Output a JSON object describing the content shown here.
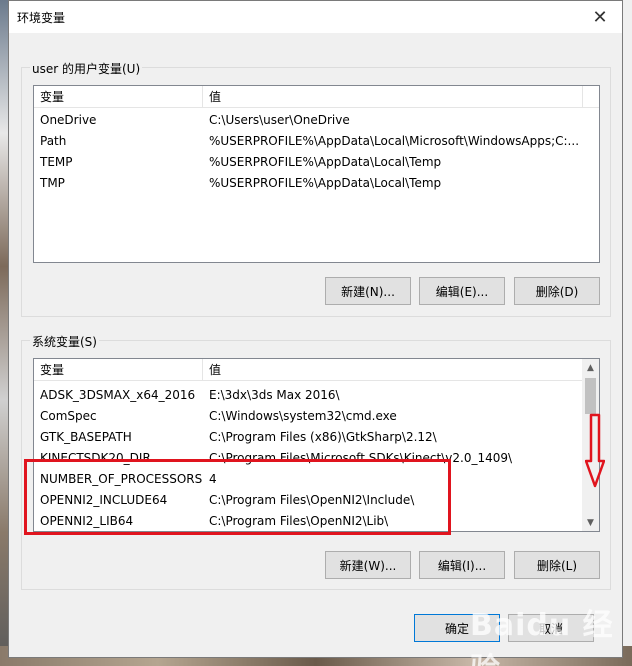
{
  "window": {
    "title": "环境变量",
    "close_glyph": "✕"
  },
  "user_section": {
    "label": "user 的用户变量(U)",
    "columns": [
      "变量",
      "值"
    ],
    "rows": [
      {
        "name": "OneDrive",
        "value": "C:\\Users\\user\\OneDrive"
      },
      {
        "name": "Path",
        "value": "%USERPROFILE%\\AppData\\Local\\Microsoft\\WindowsApps;C:..."
      },
      {
        "name": "TEMP",
        "value": "%USERPROFILE%\\AppData\\Local\\Temp"
      },
      {
        "name": "TMP",
        "value": "%USERPROFILE%\\AppData\\Local\\Temp"
      }
    ],
    "buttons": {
      "new": "新建(N)...",
      "edit": "编辑(E)...",
      "delete": "删除(D)"
    }
  },
  "system_section": {
    "label": "系统变量(S)",
    "columns": [
      "变量",
      "值"
    ],
    "rows": [
      {
        "name": "ADSK_3DSMAX_x64_2016",
        "value": "E:\\3dx\\3ds Max 2016\\"
      },
      {
        "name": "ComSpec",
        "value": "C:\\Windows\\system32\\cmd.exe"
      },
      {
        "name": "GTK_BASEPATH",
        "value": "C:\\Program Files (x86)\\GtkSharp\\2.12\\"
      },
      {
        "name": "KINECTSDK20_DIR",
        "value": "C:\\Program Files\\Microsoft SDKs\\Kinect\\v2.0_1409\\"
      },
      {
        "name": "NUMBER_OF_PROCESSORS",
        "value": "4"
      },
      {
        "name": "OPENNI2_INCLUDE64",
        "value": "C:\\Program Files\\OpenNI2\\Include\\"
      },
      {
        "name": "OPENNI2_LIB64",
        "value": "C:\\Program Files\\OpenNI2\\Lib\\"
      }
    ],
    "buttons": {
      "new": "新建(W)...",
      "edit": "编辑(I)...",
      "delete": "删除(L)"
    }
  },
  "footer": {
    "ok": "确定",
    "cancel": "取消"
  },
  "watermark": "Baidu 经验",
  "colors": {
    "highlight": "#e0141e",
    "accent": "#0078d7"
  }
}
